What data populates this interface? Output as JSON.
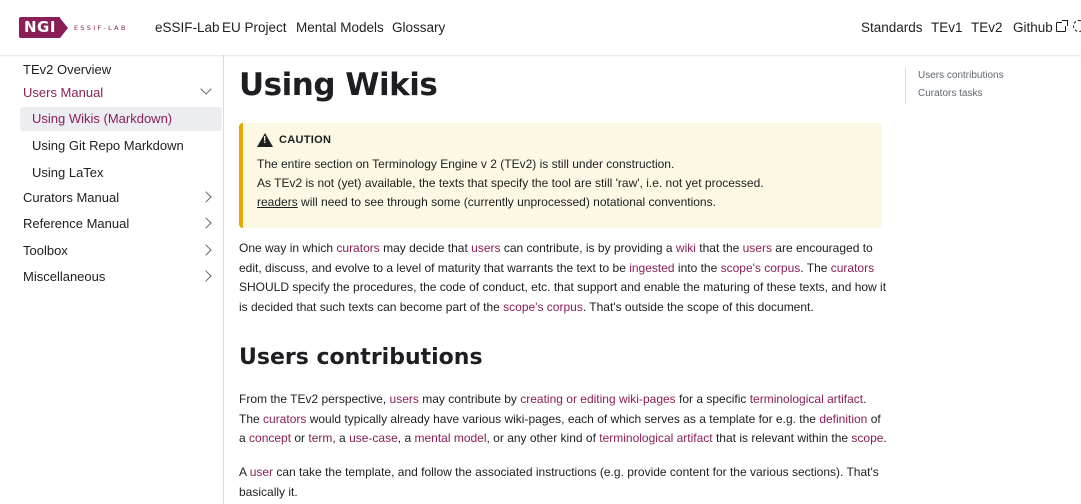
{
  "navbar": {
    "logo_text": "NGI",
    "logo_sub": "ESSIF-LAB",
    "left_links": [
      "eSSIF-Lab",
      "EU Project",
      "Mental Models",
      "Glossary"
    ],
    "right_links": [
      "Standards",
      "TEv1",
      "TEv2",
      "Github"
    ]
  },
  "sidebar": {
    "items": [
      {
        "label": "TEv2 Overview"
      },
      {
        "label": "Users Manual"
      },
      {
        "label": "Using Wikis (Markdown)"
      },
      {
        "label": "Using Git Repo Markdown"
      },
      {
        "label": "Using LaTex"
      },
      {
        "label": "Curators Manual"
      },
      {
        "label": "Reference Manual"
      },
      {
        "label": "Toolbox"
      },
      {
        "label": "Miscellaneous"
      }
    ]
  },
  "main": {
    "title": "Using Wikis",
    "caution": {
      "heading": "CAUTION",
      "lines": [
        "The entire section on Terminology Engine v 2 (TEv2) is still under construction.",
        "As TEv2 is not (yet) available, the texts that specify the tool are still 'raw', i.e. not yet processed.",
        "readers",
        " will need to see through some (currently unprocessed) notational conventions."
      ]
    },
    "para1": [
      "One way in which ",
      "curators",
      " may decide that ",
      "users",
      " can contribute, is by providing a ",
      "wiki",
      " that the ",
      "users",
      " are encouraged to edit, discuss, and evolve to a level of maturity that warrants the text to be ",
      "ingested",
      " into the ",
      "scope's corpus",
      ". The ",
      "curators",
      " SHOULD specify the procedures, the code of conduct, etc. that support and enable the maturing of these texts, and how it is decided that such texts can become part of the ",
      "scope's corpus",
      ". That's outside the scope of this document."
    ],
    "section_title": "Users contributions",
    "para2": [
      "From the TEv2 perspective, ",
      "users",
      " may contribute by ",
      "creating or editing wiki-pages",
      " for a specific ",
      "terminological artifact",
      ". The ",
      "curators",
      " would typically already have various wiki-pages, each of which serves as a template for e.g. the ",
      "definition",
      " of a ",
      "concept",
      " or ",
      "term",
      ", a ",
      "use-case",
      ", a ",
      "mental model",
      ", or any other kind of ",
      "terminological artifact",
      " that is relevant within the ",
      "scope",
      "."
    ],
    "para3": [
      "A ",
      "user",
      " can take the template, and follow the associated instructions (e.g. provide content for the various sections). That's basically it."
    ]
  },
  "toc": {
    "items": [
      "Users contributions",
      "Curators tasks"
    ]
  }
}
